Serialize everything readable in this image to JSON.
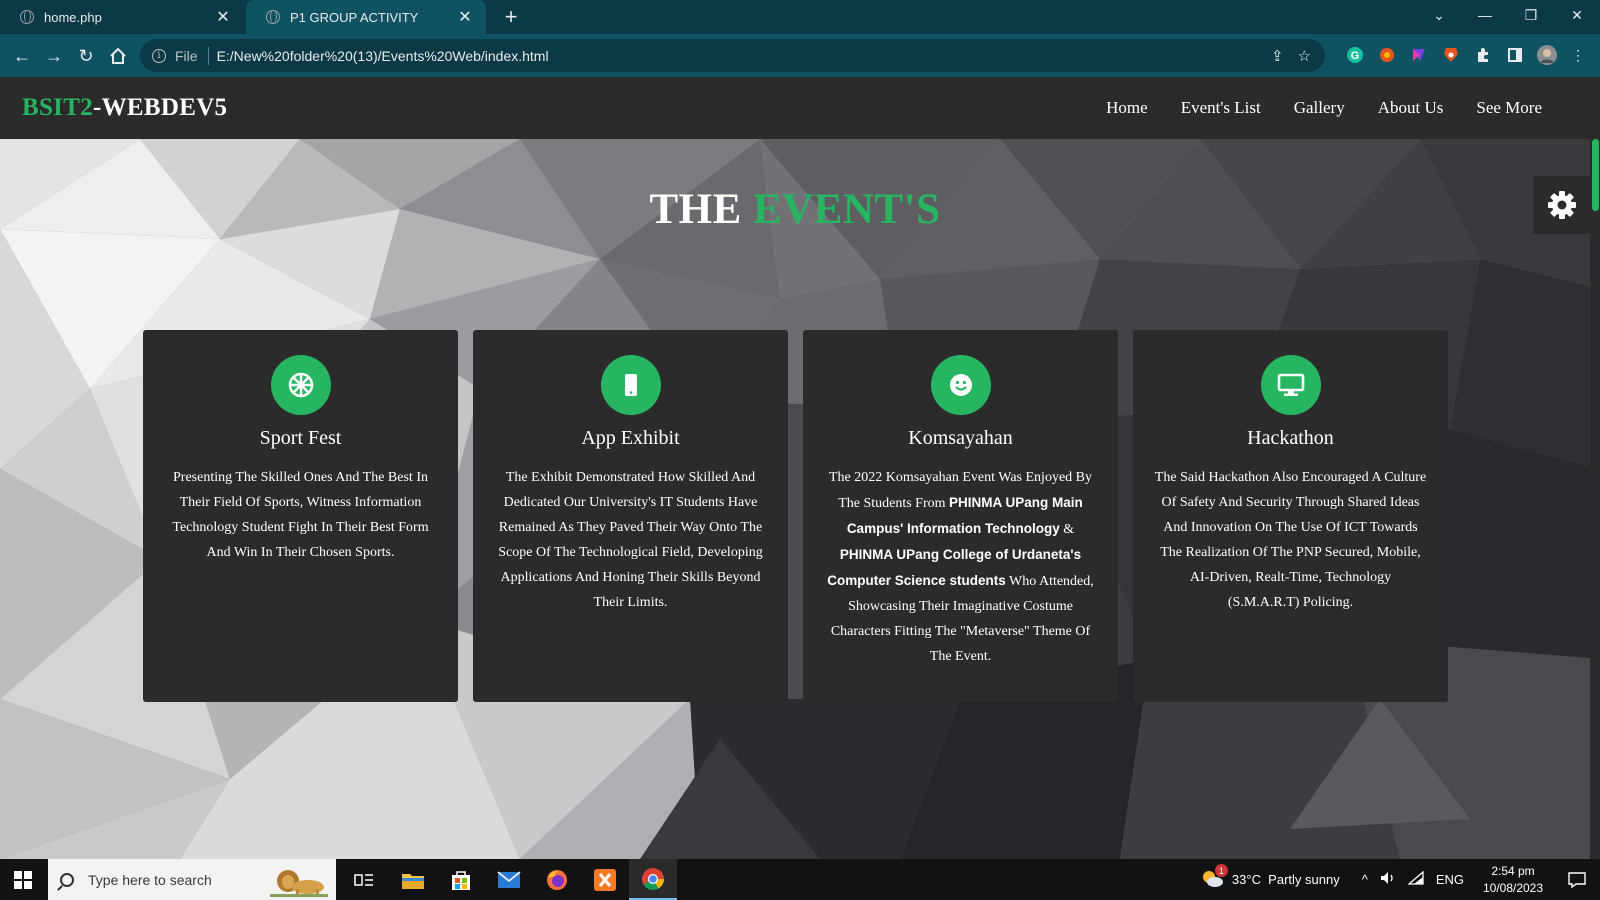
{
  "browser": {
    "tabs": [
      {
        "title": "home.php",
        "active": false
      },
      {
        "title": "P1 GROUP ACTIVITY",
        "active": true
      }
    ],
    "address": {
      "scheme_label": "File",
      "url": "E:/New%20folder%20(13)/Events%20Web/index.html"
    }
  },
  "site": {
    "logo_green": "BSIT2",
    "logo_white": "-WEBDEV5",
    "nav": [
      {
        "label": "Home"
      },
      {
        "label": "Event's List"
      },
      {
        "label": "Gallery"
      },
      {
        "label": "About Us"
      },
      {
        "label": "See More"
      }
    ],
    "headline_white": "THE",
    "headline_green": "EVENT'S",
    "cards": [
      {
        "icon": "basketball-icon",
        "title": "Sport Fest",
        "text": "Presenting The Skilled Ones And The Best In Their Field Of Sports, Witness Information Technology Student Fight In Their Best Form And Win In Their Chosen Sports."
      },
      {
        "icon": "mobile-icon",
        "title": "App Exhibit",
        "text": "The Exhibit Demonstrated How Skilled And Dedicated Our University's IT Students Have Remained As They Paved Their Way Onto The Scope Of The Technological Field, Developing Applications And Honing Their Skills Beyond Their Limits."
      },
      {
        "icon": "smiley-icon",
        "title": "Komsayahan",
        "text_part1": "The 2022 Komsayahan Event Was Enjoyed By The Students From ",
        "text_bold1": "PHINMA UPang Main Campus' Information Technology",
        "text_part2": " & ",
        "text_bold2": "PHINMA UPang College of Urdaneta's Computer Science students",
        "text_part3": " Who Attended, Showcasing Their Imaginative Costume Characters Fitting The \"Metaverse\" Theme Of The Event."
      },
      {
        "icon": "desktop-icon",
        "title": "Hackathon",
        "text": "The Said Hackathon Also Encouraged A Culture Of Safety And Security Through Shared Ideas And Innovation On The Use Of ICT Towards The Realization Of The PNP Secured, Mobile, AI-Driven, Realt-Time, Technology (S.M.A.R.T) Policing."
      }
    ]
  },
  "taskbar": {
    "search_placeholder": "Type here to search",
    "weather_badge": "1",
    "weather": "33°C  Partly sunny",
    "language": "ENG",
    "time": "2:54 pm",
    "date": "10/08/2023"
  },
  "colors": {
    "accent_green": "#27b562",
    "panel": "#2b2b2b",
    "chrome_dark": "#0b3946",
    "chrome_toolbar": "#0f5363"
  }
}
